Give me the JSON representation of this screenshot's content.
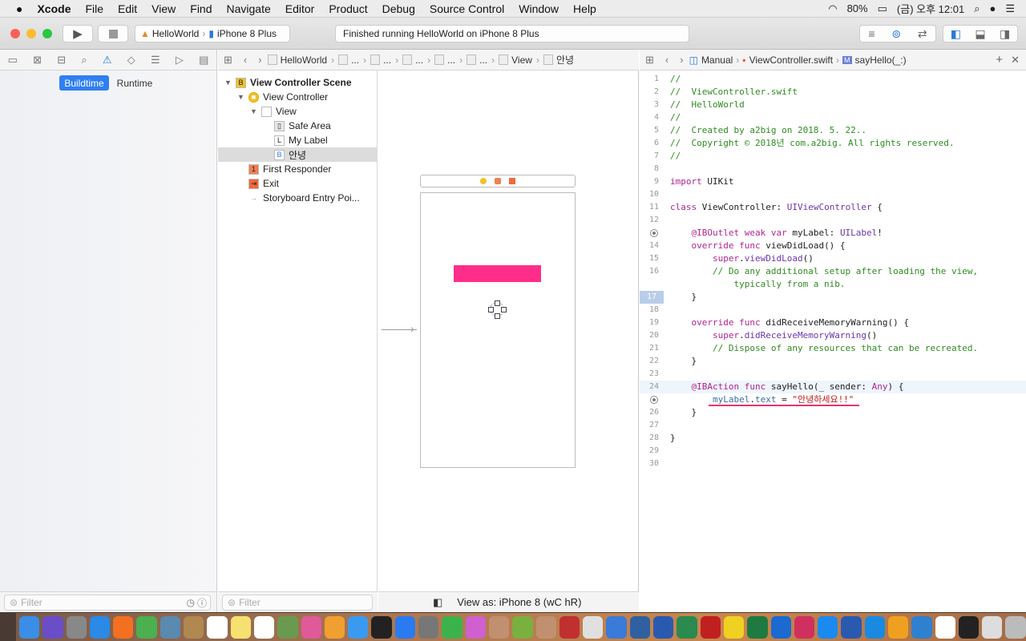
{
  "menubar": {
    "apple": "",
    "app": "Xcode",
    "items": [
      "File",
      "Edit",
      "View",
      "Find",
      "Navigate",
      "Editor",
      "Product",
      "Debug",
      "Source Control",
      "Window",
      "Help"
    ],
    "battery": "80%",
    "clock": "(금) 오후 12:01"
  },
  "toolbar": {
    "scheme": "HelloWorld",
    "device": "iPhone 8 Plus",
    "status": "Finished running HelloWorld on iPhone 8 Plus"
  },
  "navigator": {
    "tabs": [
      "folder-icon",
      "source-control-icon",
      "hierarchy-icon",
      "search-icon",
      "warning-icon",
      "test-icon",
      "debug-icon",
      "breakpoint-icon",
      "report-icon"
    ],
    "segments": [
      "Buildtime",
      "Runtime"
    ],
    "filter_placeholder": "Filter"
  },
  "ib_jumpbar": {
    "items": [
      "HelloWorld",
      "...",
      "...",
      "...",
      "...",
      "...",
      "View",
      "안녕"
    ]
  },
  "outline": {
    "items": [
      {
        "label": "View Controller Scene",
        "icon": "B",
        "bold": true
      },
      {
        "label": "View Controller",
        "icon": "■"
      },
      {
        "label": "View",
        "icon": ""
      },
      {
        "label": "Safe Area",
        "icon": "▯"
      },
      {
        "label": "My Label",
        "icon": "L"
      },
      {
        "label": "안녕",
        "icon": "B",
        "selected": true
      },
      {
        "label": "First Responder",
        "icon": "1"
      },
      {
        "label": "Exit",
        "icon": "⇥"
      },
      {
        "label": "Storyboard Entry Poi...",
        "icon": "→"
      }
    ],
    "filter_placeholder": "Filter"
  },
  "canvas": {
    "label_color": "#ff2d8a",
    "view_as": "View as: iPhone 8 (wC hR)"
  },
  "editor_jumpbar": {
    "items": [
      "Manual",
      "ViewController.swift",
      "sayHello(_:)"
    ]
  },
  "code": {
    "lines": [
      [
        [
          "//",
          "c"
        ]
      ],
      [
        [
          "//  ViewController.swift",
          "c"
        ]
      ],
      [
        [
          "//  HelloWorld",
          "c"
        ]
      ],
      [
        [
          "//",
          "c"
        ]
      ],
      [
        [
          "//  Created by a2big on 2018. 5. 22..",
          "c"
        ]
      ],
      [
        [
          "//  Copyright © 2018년 com.a2big. All rights reserved.",
          "c"
        ]
      ],
      [
        [
          "//",
          "c"
        ]
      ],
      [],
      [
        [
          "import",
          "k"
        ],
        [
          " UIKit",
          "p"
        ]
      ],
      [],
      [
        [
          "class",
          "k"
        ],
        [
          " ViewController: ",
          "p"
        ],
        [
          "UIViewController",
          "t"
        ],
        [
          " {",
          "p"
        ]
      ],
      [],
      [
        [
          "    @IBOutlet weak var",
          "k"
        ],
        [
          " myLabel: ",
          "p"
        ],
        [
          "UILabel",
          "t"
        ],
        [
          "!",
          "p"
        ]
      ],
      [
        [
          "    override func",
          "k"
        ],
        [
          " viewDidLoad() {",
          "p"
        ]
      ],
      [
        [
          "        super",
          "k"
        ],
        [
          ".",
          "p"
        ],
        [
          "viewDidLoad",
          "t"
        ],
        [
          "()",
          "p"
        ]
      ],
      [
        [
          "        // Do any additional setup after loading the view,",
          "c"
        ]
      ],
      [
        [
          "            typically from a nib.",
          "c"
        ]
      ],
      [
        [
          "    }",
          "p"
        ]
      ],
      [],
      [
        [
          "    override func",
          "k"
        ],
        [
          " didReceiveMemoryWarning() {",
          "p"
        ]
      ],
      [
        [
          "        super",
          "k"
        ],
        [
          ".",
          "p"
        ],
        [
          "didReceiveMemoryWarning",
          "t"
        ],
        [
          "()",
          "p"
        ]
      ],
      [
        [
          "        // Dispose of any resources that can be recreated.",
          "c"
        ]
      ],
      [
        [
          "    }",
          "p"
        ]
      ],
      [],
      [
        [
          "    @IBAction func",
          "k"
        ],
        [
          " sayHello(_ sender: ",
          "p"
        ],
        [
          "Any",
          "k"
        ],
        [
          ") {",
          "p"
        ]
      ],
      [
        [
          "        myLabel",
          "f"
        ],
        [
          ".",
          "p"
        ],
        [
          "text",
          "f"
        ],
        [
          " = ",
          "p"
        ],
        [
          "\"안녕하세요!!\"",
          "s"
        ]
      ],
      [
        [
          "    }",
          "p"
        ]
      ],
      [],
      [
        [
          "}",
          "p"
        ]
      ],
      [],
      []
    ],
    "numbers": [
      "1",
      "2",
      "3",
      "4",
      "5",
      "6",
      "7",
      "8",
      "9",
      "10",
      "11",
      "12",
      "13",
      "14",
      "15",
      "16",
      "",
      "17",
      "18",
      "19",
      "20",
      "21",
      "22",
      "23",
      "24",
      "25",
      "26",
      "27",
      "28",
      "29",
      "30"
    ],
    "breakpoint_lines": [
      13,
      25
    ],
    "current_line": 17
  },
  "dock": {
    "apps": [
      "Finder",
      "Siri",
      "Launchpad",
      "Safari",
      "Firefox",
      "Chrome",
      "Preview",
      "Notes",
      "Calendar",
      "Stickies",
      "Reminders",
      "Maps",
      "iTunes",
      "Photos",
      "Messages",
      "Terminal",
      "App Store",
      "System Preferences",
      "FaceTime",
      "Flower",
      "?",
      "Android Studio",
      "?",
      "Parallels",
      "Migration",
      "Xcode",
      "Instruments",
      "VS Code",
      "PyCharm",
      "FileZilla",
      "KakaoTalk",
      "Excel",
      "Outlook",
      "Airmail",
      "Infuse",
      "Word",
      "TeamViewer",
      "Pages",
      "Keynote",
      "Docs",
      "Terminal2",
      "Preview2",
      "Trash"
    ]
  }
}
